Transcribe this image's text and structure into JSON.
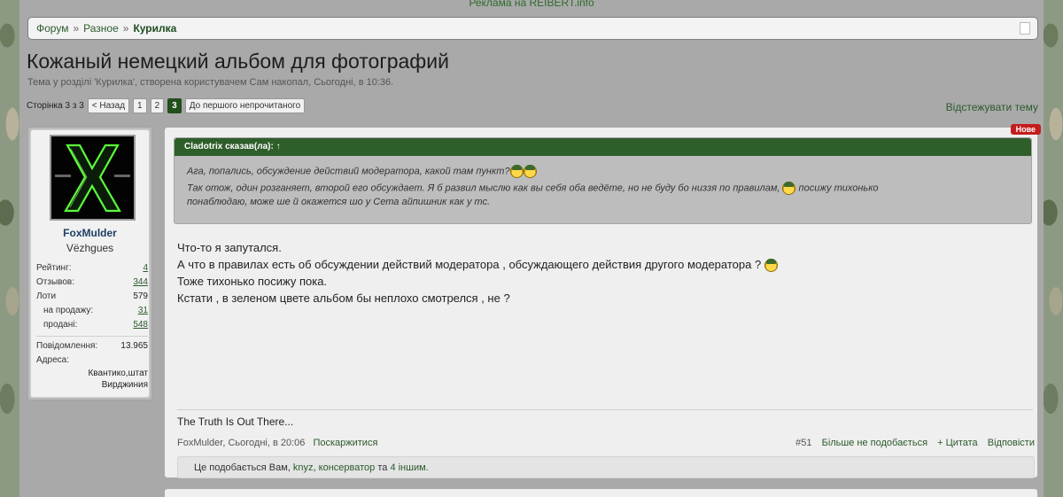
{
  "ad": {
    "text": "Реклама на REIBERT.info"
  },
  "breadcrumb": {
    "items": [
      "Форум",
      "Разное",
      "Курилка"
    ],
    "sep": "»"
  },
  "thread": {
    "title": "Кожаный немецкий альбом для фотографий",
    "desc": "Тема у розділі 'Курилка', створена користувачем Сам накопал, Сьогодні, в 10:36."
  },
  "pagenav": {
    "label": "Сторінка 3 з 3",
    "prev": "< Назад",
    "pages": [
      "1",
      "2",
      "3"
    ],
    "unread": "До першого непрочитаного"
  },
  "watch": "Відстежувати тему",
  "user": {
    "name": "FoxMulder",
    "title": "Vëzhgues",
    "stats": [
      {
        "label": "Рейтинг:",
        "value": "4"
      },
      {
        "label": "Отзывов:",
        "value": "344"
      },
      {
        "label": "Лоти",
        "value": "579"
      },
      {
        "label": "на продажу:",
        "value": "31"
      },
      {
        "label": "продані:",
        "value": "548"
      }
    ],
    "messages_label": "Повідомлення:",
    "messages": "13.965",
    "address_label": "Адреса:",
    "address_line1": "Квантико,штат",
    "address_line2": "Вирджиния"
  },
  "post": {
    "new_badge": "Нове",
    "quote_head": "Cladotrix сказав(ла): ↑",
    "quote_line1": "Ага, попались, обсуждение действий модератора, какой там пункт?",
    "quote_line2": "Так отож, один розганяет, второй его обсуждает. Я б развил мыслю как вы себя оба ведёте, но не буду бо низзя по правилам,",
    "quote_line2b": "посижу тихонько",
    "quote_line3": "понаблюдаю, може ше й окажется шо у Сета айпишник как у тс.",
    "text_line1": "Что-то я запутался.",
    "text_line2": "А что в правилах есть об обсуждении действий модератора , обсуждающего действия другого модератора ?",
    "text_line3": "Тоже тихонько посижу пока.",
    "text_line4": "Кстати , в зеленом цвете альбом бы неплохо смотрелся , не ?",
    "signature": "The Truth Is Out There...",
    "author_time": "FoxMulder, Сьогодні, в 20:06",
    "report": "Поскаржитися",
    "number": "#51",
    "unlike": "Більше не подобається",
    "quote_btn": "+ Цитата",
    "reply": "Відповісти",
    "likes_prefix": "Це подобається Вам,",
    "likes_user1": "knyz",
    "likes_user2": "консерватор",
    "likes_and": "та",
    "likes_more": "4 іншим."
  }
}
